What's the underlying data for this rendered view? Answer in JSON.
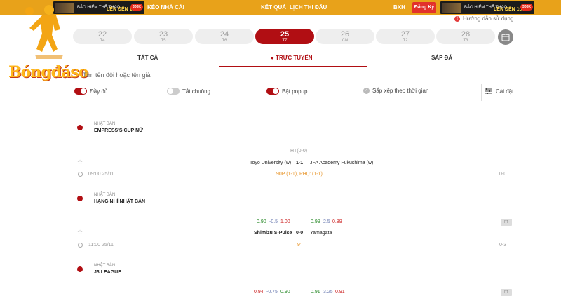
{
  "header": {
    "banner_title": "BẢO HIỂM THỂ THAO",
    "banner_subtitle": "LÊN ĐẾN 10%",
    "banner_amount": "300K",
    "nav_keo": "KÈO NHÀ CÁI",
    "nav_ketqua": "KẾT QUẢ",
    "nav_lich": "LỊCH THI ĐẤU",
    "nav_bxh": "BXH",
    "register": "Đăng Ký",
    "guide": "Hướng dẫn sử dụng",
    "logo": "Bóngđáso"
  },
  "days": [
    {
      "n": "22",
      "w": "T4"
    },
    {
      "n": "23",
      "w": "T5"
    },
    {
      "n": "24",
      "w": "T6"
    },
    {
      "n": "25",
      "w": "T7"
    },
    {
      "n": "26",
      "w": "CN"
    },
    {
      "n": "27",
      "w": "T2"
    },
    {
      "n": "28",
      "w": "T3"
    }
  ],
  "tabs": {
    "all": "TẤT CẢ",
    "live": "● TRỰC TUYẾN",
    "upcoming": "SẮP ĐÁ"
  },
  "search": {
    "placeholder": "Tìm tên đội hoặc tên giải"
  },
  "filters": {
    "full": "Đầy đủ",
    "mute": "Tắt chuông",
    "popup": "Bật popup",
    "sort": "Sắp xếp theo thời gian",
    "settings": "Cài đặt"
  },
  "leagues": [
    {
      "country": "NHẬT BẢN",
      "name": "EMPRESS'S CUP NỮ",
      "match": {
        "ht": "HT(0-0)",
        "home": "Toyo University (w)",
        "score": "1-1",
        "away": "JFA Academy Fukushima (w)",
        "time": "09:00 25/11",
        "status": "90P (1-1), PHỤ' (1-1)",
        "corner": "0-0"
      }
    },
    {
      "country": "NHẬT BẢN",
      "name": "HẠNG NHÌ NHẬT BẢN",
      "match": {
        "odds_home": [
          "0.90",
          "-0.5",
          "1.00"
        ],
        "odds_away": [
          "0.99",
          "2.5",
          "0.89"
        ],
        "home": "Shimizu S-Pulse",
        "score": "0-0",
        "away": "Yamagata",
        "time": "11:00 25/11",
        "status": "9'",
        "corner": "0-3",
        "ft": "FT"
      }
    },
    {
      "country": "NHẬT BẢN",
      "name": "J3 LEAGUE",
      "match": {
        "odds_home": [
          "0.94",
          "-0.75",
          "0.90"
        ],
        "odds_away": [
          "0.91",
          "3.25",
          "0.91"
        ],
        "ft": "FT"
      }
    }
  ]
}
